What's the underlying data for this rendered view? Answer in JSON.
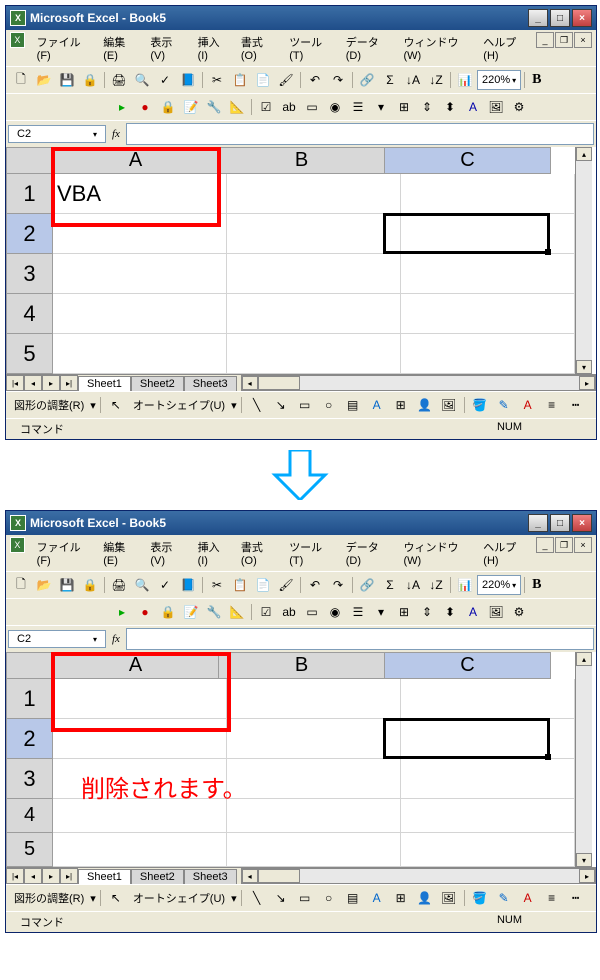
{
  "title": "Microsoft Excel - Book5",
  "menus": {
    "file": "ファイル(F)",
    "edit": "編集(E)",
    "view": "表示(V)",
    "insert": "挿入(I)",
    "format": "書式(O)",
    "tools": "ツール(T)",
    "data": "データ(D)",
    "window": "ウィンドウ(W)",
    "help": "ヘルプ(H)"
  },
  "zoom": "220%",
  "bold_label": "B",
  "namebox": "C2",
  "fx": "fx",
  "columns": [
    "A",
    "B",
    "C"
  ],
  "rows": [
    "1",
    "2",
    "3",
    "4",
    "5"
  ],
  "top_cells": {
    "a1": "VBA"
  },
  "bottom_cells": {
    "a1": ""
  },
  "annotation": "削除されます。",
  "sheets": {
    "nav": [
      "|◂",
      "◂",
      "▸",
      "▸|"
    ],
    "tabs": [
      "Sheet1",
      "Sheet2",
      "Sheet3"
    ]
  },
  "drawing": {
    "adjust": "図形の調整(R)",
    "autoshape": "オートシェイプ(U)"
  },
  "status": {
    "cmd": "コマンド",
    "num": "NUM"
  },
  "win_btns": {
    "min": "_",
    "max": "□",
    "close": "×"
  }
}
